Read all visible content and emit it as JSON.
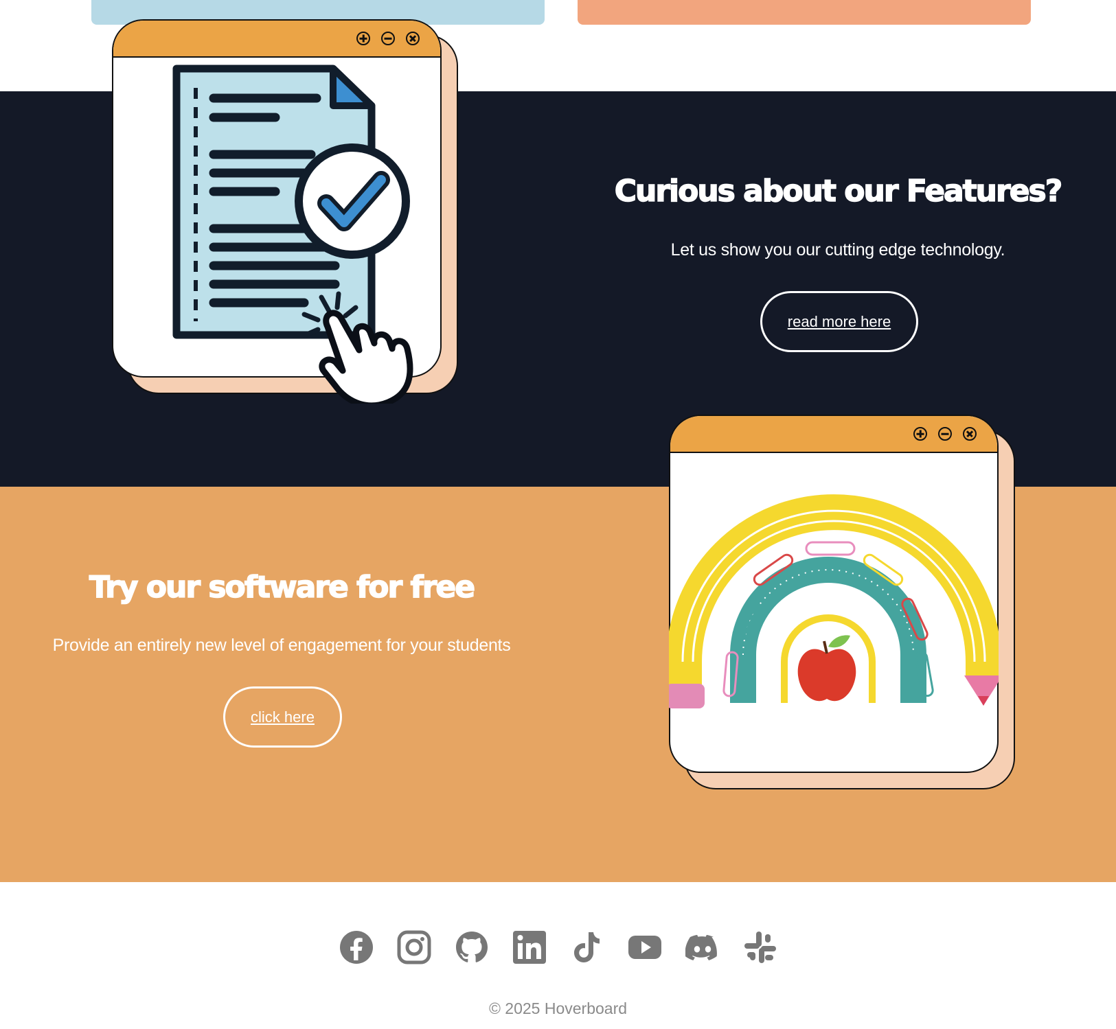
{
  "features": {
    "heading": "Curious about our Features?",
    "subtext": "Let us show you our cutting edge technology.",
    "button_label": "read more here"
  },
  "free": {
    "heading": "Try our software for free",
    "subtext": "Provide an entirely new level of engagement for your students",
    "button_label": "click here"
  },
  "footer": {
    "socials": [
      "facebook-icon",
      "instagram-icon",
      "github-icon",
      "linkedin-icon",
      "tiktok-icon",
      "youtube-icon",
      "discord-icon",
      "slack-icon"
    ],
    "copyright": "© 2025 Hoverboard"
  },
  "colors": {
    "dark_section": "#141927",
    "orange_section": "#e6a563",
    "titlebar": "#eba446",
    "card_blue": "#b6d9e6",
    "card_orange": "#f2a57e",
    "icon_gray": "#777777"
  }
}
